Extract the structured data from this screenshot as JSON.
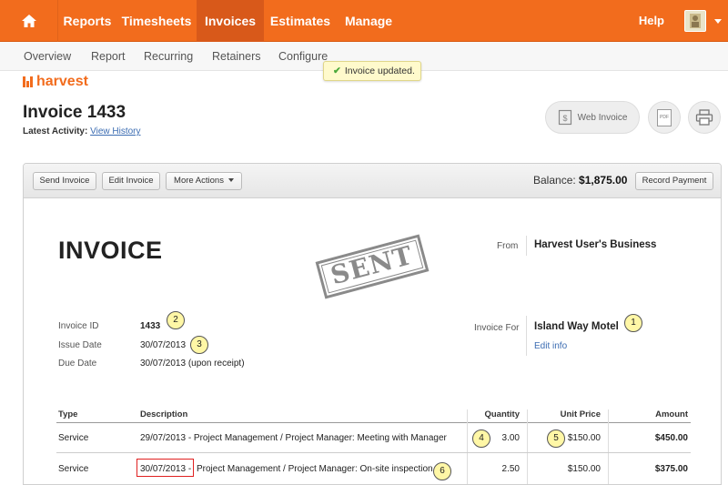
{
  "topnav": {
    "home_icon": "home-icon",
    "items": [
      {
        "label": "Reports"
      },
      {
        "label": "Timesheets"
      },
      {
        "label": "Invoices",
        "active": true
      },
      {
        "label": "Estimates"
      },
      {
        "label": "Manage"
      }
    ],
    "help_label": "Help",
    "accent_color": "#f26c1d"
  },
  "subnav": {
    "items": [
      {
        "label": "Overview"
      },
      {
        "label": "Report"
      },
      {
        "label": "Recurring"
      },
      {
        "label": "Retainers"
      },
      {
        "label": "Configure"
      }
    ]
  },
  "toast": {
    "text": "Invoice updated."
  },
  "logo": {
    "text": "harvest"
  },
  "page": {
    "title": "Invoice 1433",
    "latest_label": "Latest Activity:",
    "history_link": "View History",
    "web_invoice_label": "Web Invoice",
    "pdf_label": "PDF"
  },
  "toolbar": {
    "send_label": "Send Invoice",
    "edit_label": "Edit Invoice",
    "more_label": "More Actions",
    "balance_label": "Balance:",
    "balance_value": "$1,875.00",
    "record_label": "Record Payment"
  },
  "invoice": {
    "heading": "INVOICE",
    "stamp": "SENT",
    "from_label": "From",
    "from_name": "Harvest User's Business",
    "for_label": "Invoice For",
    "for_name": "Island Way Motel",
    "edit_info": "Edit info",
    "id_label": "Invoice ID",
    "id_value": "1433",
    "issue_label": "Issue Date",
    "issue_value": "30/07/2013",
    "due_label": "Due Date",
    "due_value": "30/07/2013 (upon receipt)"
  },
  "callouts": [
    "1",
    "2",
    "3",
    "4",
    "5",
    "6"
  ],
  "table": {
    "headers": {
      "type": "Type",
      "description": "Description",
      "quantity": "Quantity",
      "unit_price": "Unit Price",
      "amount": "Amount"
    },
    "rows": [
      {
        "type": "Service",
        "description": "29/07/2013 - Project Management / Project Manager: Meeting with Manager",
        "quantity": "3.00",
        "unit_price": "$150.00",
        "amount": "$450.00"
      },
      {
        "type": "Service",
        "date": "30/07/2013 -",
        "description": "Project Management / Project Manager: On-site inspection",
        "quantity": "2.50",
        "unit_price": "$150.00",
        "amount": "$375.00"
      }
    ]
  }
}
